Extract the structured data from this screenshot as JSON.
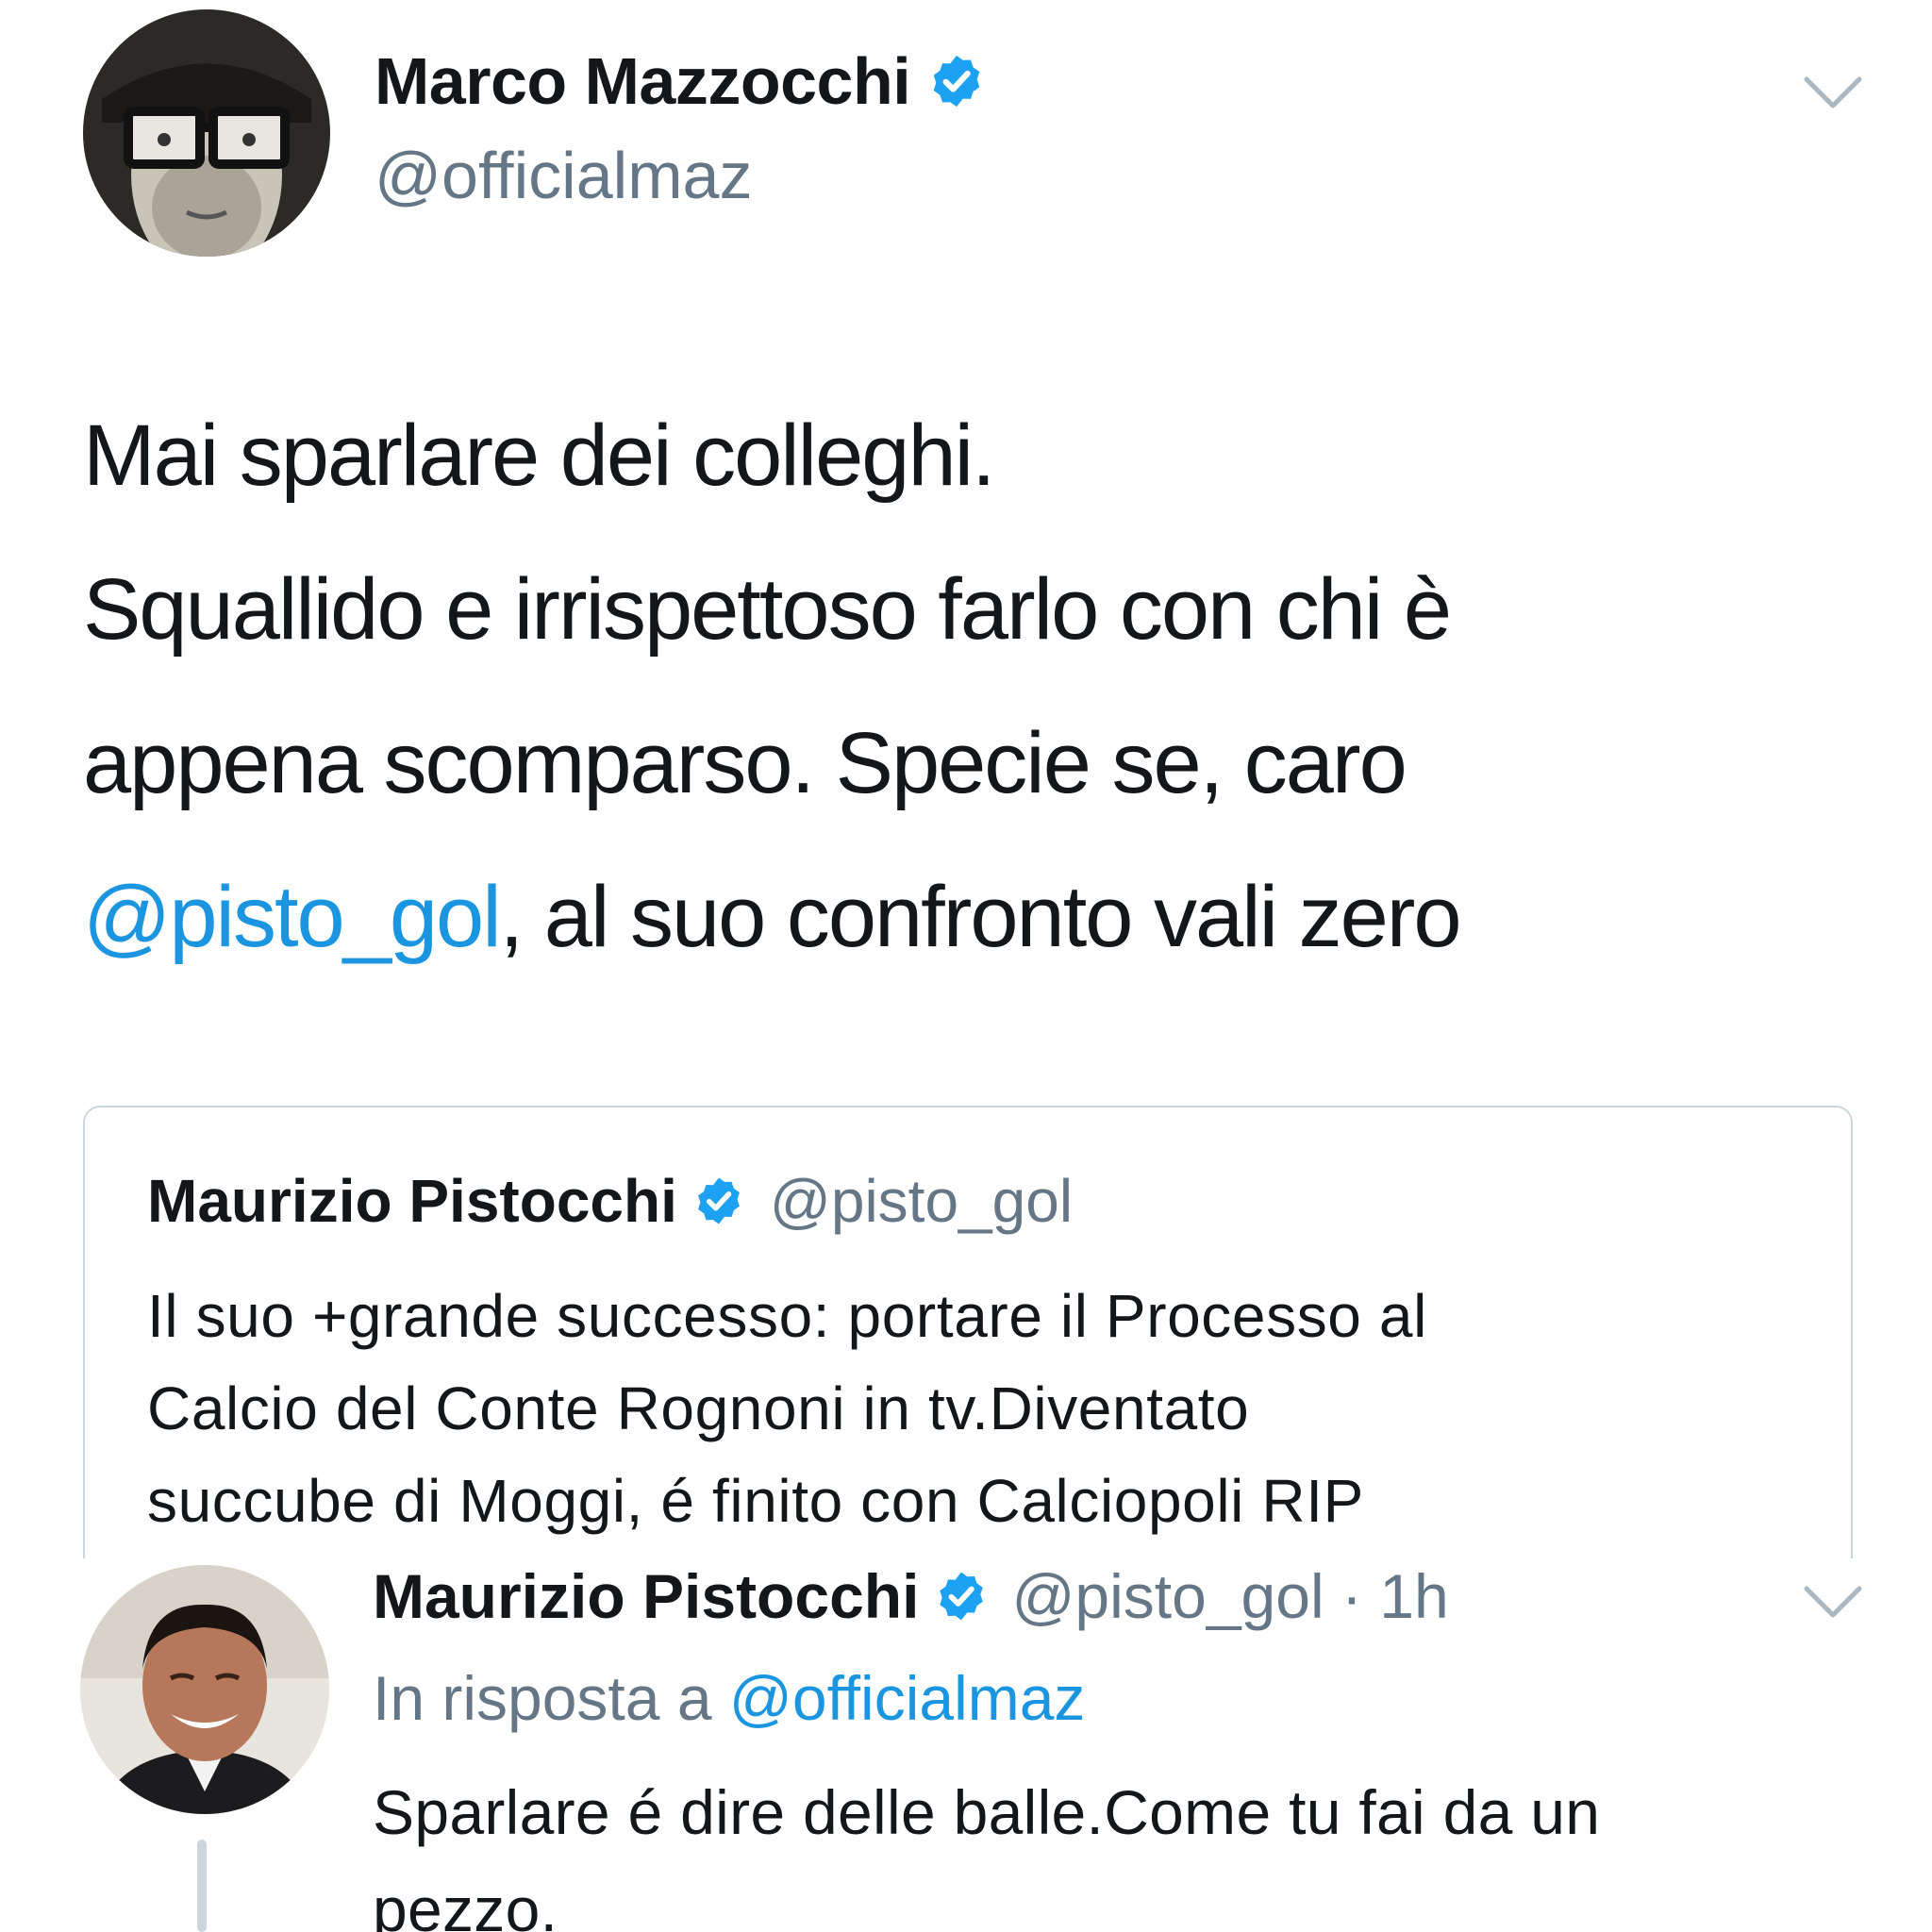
{
  "colors": {
    "text_primary": "#14171a",
    "text_secondary": "#657786",
    "link": "#1b95e0",
    "verified": "#1da1f2",
    "border": "#ccd6dd"
  },
  "main_tweet": {
    "author_name": "Marco Mazzocchi",
    "handle": "@officialmaz",
    "verified": true,
    "body": {
      "line1": "Mai sparlare dei colleghi.",
      "line2": "Squallido e irrispettoso farlo con chi è",
      "line3": "appena scomparso. Specie se, caro",
      "line4_mention": "@pisto_gol",
      "line4_rest": ", al suo confronto vali zero"
    },
    "menu_icon": "chevron-down-icon"
  },
  "quoted_tweet": {
    "author_name": "Maurizio Pistocchi",
    "handle": "@pisto_gol",
    "verified": true,
    "text": {
      "line1": "Il suo +grande successo: portare il Processo al",
      "line2": "Calcio del Conte Rognoni in tv.Diventato",
      "line3": "succube di Moggi, é finito con Calciopoli RIP"
    }
  },
  "reply_tweet": {
    "author_name": "Maurizio Pistocchi",
    "handle_time": "@pisto_gol · 1h",
    "verified": true,
    "reply_prefix": "In risposta a ",
    "reply_to": "@officialmaz",
    "text": {
      "line1": "Sparlare é dire delle balle.Come tu fai da un",
      "line2": "pezzo."
    },
    "menu_icon": "chevron-down-icon"
  }
}
